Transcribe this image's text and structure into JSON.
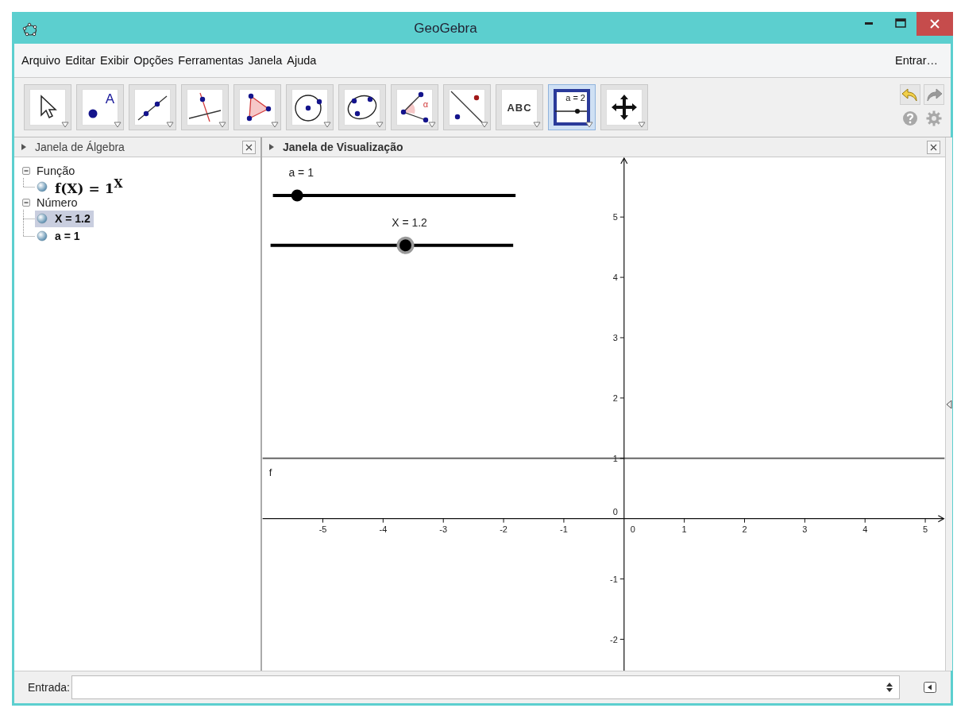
{
  "window": {
    "title": "GeoGebra"
  },
  "menu": {
    "items": [
      "Arquivo",
      "Editar",
      "Exibir",
      "Opções",
      "Ferramentas",
      "Janela",
      "Ajuda"
    ],
    "login": "Entrar…"
  },
  "toolbar": {
    "tools": [
      {
        "kind": "move",
        "selected": false
      },
      {
        "kind": "point",
        "label": "A",
        "selected": false
      },
      {
        "kind": "line",
        "selected": false
      },
      {
        "kind": "perpendicular",
        "selected": false
      },
      {
        "kind": "polygon",
        "selected": false
      },
      {
        "kind": "circle",
        "selected": false
      },
      {
        "kind": "conic",
        "selected": false
      },
      {
        "kind": "angle",
        "label": "α",
        "selected": false
      },
      {
        "kind": "reflect",
        "selected": false
      },
      {
        "kind": "text",
        "label": "ABC",
        "selected": false
      },
      {
        "kind": "slider",
        "label": "a = 2",
        "selected": true
      },
      {
        "kind": "pan",
        "selected": false
      }
    ],
    "history": [
      {
        "kind": "undo",
        "disabled": false
      },
      {
        "kind": "redo",
        "disabled": true
      }
    ]
  },
  "algebra": {
    "title": "Janela de Álgebra",
    "active": false,
    "groups": [
      {
        "label": "Função",
        "expanded": true,
        "children": [
          {
            "text": "f(X) = 1$^{X}$",
            "kind": "formula",
            "selected": false
          }
        ]
      },
      {
        "label": "Número",
        "expanded": true,
        "children": [
          {
            "text": "X = 1.2",
            "kind": "plain",
            "selected": true
          },
          {
            "text": "a = 1",
            "kind": "plain",
            "selected": false
          }
        ]
      }
    ]
  },
  "graphics": {
    "title": "Janela de Visualização",
    "active": true,
    "sliders": [
      {
        "label": "a = 1",
        "level": 0.1,
        "selected": false
      },
      {
        "label": "X = 1.2",
        "level": 0.556,
        "selected": true
      }
    ],
    "chart_data": {
      "type": "line",
      "x": [
        -6,
        5.32
      ],
      "xlim": [
        -6,
        5.32
      ],
      "ylim": [
        -2.52,
        5.99
      ],
      "xticks": [
        -5,
        -4,
        -3,
        -2,
        -1,
        1,
        2,
        3,
        4,
        5
      ],
      "yticks": [
        -2,
        -1,
        1,
        2,
        3,
        4,
        5
      ],
      "series": [
        {
          "name": "f",
          "color": "#666666",
          "values": [
            1,
            1
          ]
        }
      ]
    },
    "origin_labels": [
      "0",
      "0"
    ]
  },
  "input": {
    "label": "Entrada:"
  }
}
